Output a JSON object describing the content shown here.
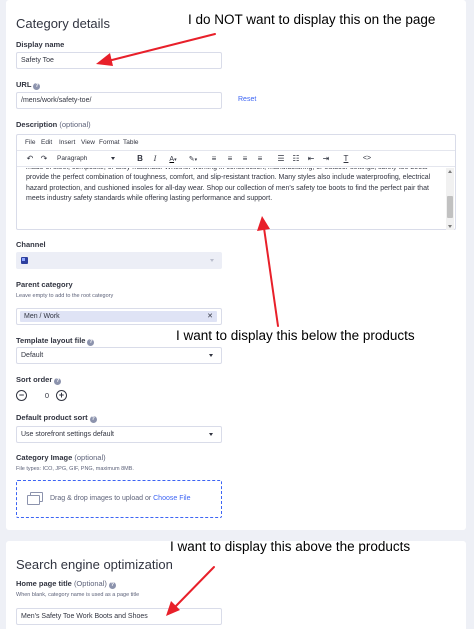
{
  "category": {
    "title": "Category details",
    "display_name_label": "Display name",
    "display_name_value": "Safety Toe",
    "url_label": "URL",
    "url_value": "/mens/work/safety-toe/",
    "reset": "Reset",
    "description_label": "Description",
    "description_optional": "(optional)",
    "menu": [
      "File",
      "Edit",
      "Insert",
      "View",
      "Format",
      "Table"
    ],
    "paragraph": "Paragraph",
    "description_text": "made of steel, composite, or alloy materials. Whether working in construction, manufacturing, or outdoor settings, safety toe boots provide the perfect combination of toughness, comfort, and slip-resistant traction. Many styles also include waterproofing, electrical hazard protection, and cushioned insoles for all-day wear. Shop our collection of men's safety toe boots to find the perfect pair that meets industry safety standards while offering lasting performance and support.",
    "channel_label": "Channel",
    "parent_label": "Parent category",
    "parent_hint": "Leave empty to add to the root category",
    "parent_value": "Men / Work",
    "layout_label": "Template layout file",
    "layout_value": "Default",
    "sort_label": "Sort order",
    "sort_value": "0",
    "product_sort_label": "Default product sort",
    "product_sort_value": "Use storefront settings default",
    "image_label": "Category Image",
    "image_optional": "(optional)",
    "image_hint": "File types: ICO, JPG, GIF, PNG, maximum 8MB.",
    "drop_text": "Drag & drop images to upload or",
    "choose_file": "Choose File"
  },
  "seo": {
    "title": "Search engine optimization",
    "page_title_label": "Home page title",
    "page_title_optional": "(Optional)",
    "page_title_hint": "When blank, category name is used as a page title",
    "page_title_value": "Men's Safety Toe Work Boots and Shoes"
  },
  "annotations": {
    "top": "I do NOT want to display this on the page",
    "middle": "I want to display this below the products",
    "bottom": "I want to display this above the products"
  },
  "colors": {
    "arrow": "#e8202a",
    "accent": "#3c64f4",
    "page_bg": "#eef0f6"
  }
}
